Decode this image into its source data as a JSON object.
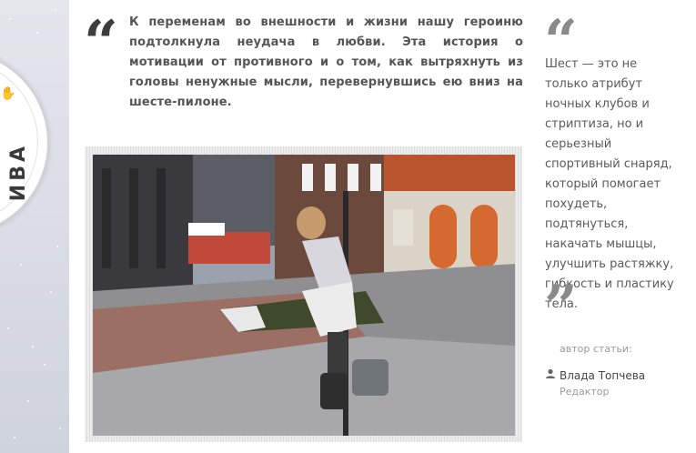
{
  "badge": {
    "text": "ИВА"
  },
  "article": {
    "lead": "К переменам во внешности и жизни нашу героиню подтолкнула неудача в любви. Эта история о мотивации от противного и о том, как вытряхнуть из головы ненужные мысли, перевернувшись ею вниз на шесте-пилоне.",
    "open_quote": "“"
  },
  "sidebar": {
    "open_quote": "“",
    "close_quote": "”",
    "pull_quote": "Шест — это не только атрибут ночных клубов и стриптиза, но и серьезный спортивный снаряд, который помогает похудеть, подтянуться, накачать мышцы, улучшить растяжку, гибкость и пластику тела."
  },
  "author": {
    "label": "автор статьи:",
    "name": "Влада Топчева",
    "role": "Редактор",
    "icon": "user-icon"
  },
  "colors": {
    "text_dark": "#555555",
    "quote_dark": "#3d3d3d",
    "quote_light": "#8a8a8a",
    "muted": "#9a9a9a"
  }
}
